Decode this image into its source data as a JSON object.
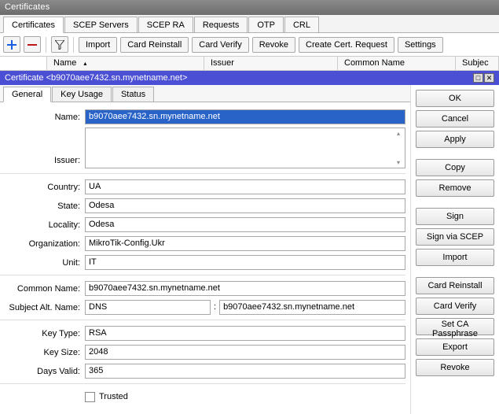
{
  "window": {
    "title": "Certificates"
  },
  "main_tabs": [
    "Certificates",
    "SCEP Servers",
    "SCEP RA",
    "Requests",
    "OTP",
    "CRL"
  ],
  "main_tabs_active": 0,
  "toolbar": {
    "import": "Import",
    "card_reinstall": "Card Reinstall",
    "card_verify": "Card Verify",
    "revoke": "Revoke",
    "create_cert_request": "Create Cert. Request",
    "settings": "Settings"
  },
  "columns": {
    "name": "Name",
    "issuer": "Issuer",
    "common_name": "Common Name",
    "subject": "Subjec"
  },
  "detail_title": "Certificate <b9070aee7432.sn.mynetname.net>",
  "detail_tabs": [
    "General",
    "Key Usage",
    "Status"
  ],
  "detail_tabs_active": 0,
  "form": {
    "labels": {
      "name": "Name:",
      "issuer": "Issuer:",
      "country": "Country:",
      "state": "State:",
      "locality": "Locality:",
      "organization": "Organization:",
      "unit": "Unit:",
      "common_name": "Common Name:",
      "san": "Subject Alt. Name:",
      "key_type": "Key Type:",
      "key_size": "Key Size:",
      "days_valid": "Days Valid:",
      "trusted": "Trusted"
    },
    "values": {
      "name": "b9070aee7432.sn.mynetname.net",
      "country": "UA",
      "state": "Odesa",
      "locality": "Odesa",
      "organization": "MikroTik-Config.Ukr",
      "unit": "IT",
      "common_name": "b9070aee7432.sn.mynetname.net",
      "san_type": "DNS",
      "san_value": "b9070aee7432.sn.mynetname.net",
      "key_type": "RSA",
      "key_size": "2048",
      "days_valid": "365",
      "trusted": false
    }
  },
  "right_buttons": {
    "ok": "OK",
    "cancel": "Cancel",
    "apply": "Apply",
    "copy": "Copy",
    "remove": "Remove",
    "sign": "Sign",
    "sign_via_scep": "Sign via SCEP",
    "import": "Import",
    "card_reinstall": "Card Reinstall",
    "card_verify": "Card Verify",
    "set_ca_passphrase": "Set CA Passphrase",
    "export": "Export",
    "revoke": "Revoke"
  }
}
